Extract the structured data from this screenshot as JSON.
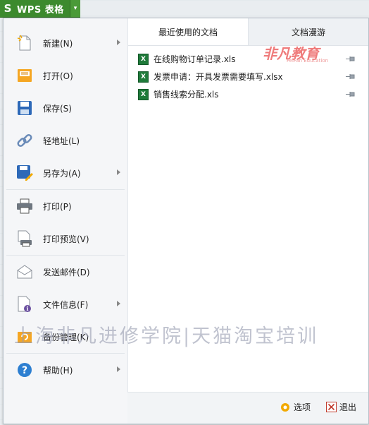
{
  "app": {
    "title": "WPS 表格"
  },
  "menu": {
    "items": [
      {
        "label": "新建(N)",
        "icon": "new-document-icon",
        "submenu": true
      },
      {
        "label": "打开(O)",
        "icon": "open-folder-icon",
        "submenu": false
      },
      {
        "label": "保存(S)",
        "icon": "save-disk-icon",
        "submenu": false
      },
      {
        "label": "轻地址(L)",
        "icon": "link-icon",
        "submenu": false
      },
      {
        "label": "另存为(A)",
        "icon": "save-as-icon",
        "submenu": true
      },
      {
        "label": "打印(P)",
        "icon": "printer-icon",
        "submenu": false
      },
      {
        "label": "打印预览(V)",
        "icon": "print-preview-icon",
        "submenu": false
      },
      {
        "label": "发送邮件(D)",
        "icon": "mail-icon",
        "submenu": false
      },
      {
        "label": "文件信息(F)",
        "icon": "file-info-icon",
        "submenu": true
      },
      {
        "label": "备份管理(K)",
        "icon": "backup-icon",
        "submenu": false
      },
      {
        "label": "帮助(H)",
        "icon": "help-icon",
        "submenu": true
      }
    ]
  },
  "tabs": {
    "recent": "最近使用的文档",
    "roaming": "文档漫游"
  },
  "recent_docs": [
    "在线购物订单记录.xls",
    "发票申请：开具发票需要填写.xlsx",
    "销售线索分配.xls"
  ],
  "footer": {
    "options": "选项",
    "exit": "退出"
  },
  "watermark": "上海非凡进修学院|天猫淘宝培训",
  "logo": {
    "text": "非凡教育",
    "sub": "FeiFan Education"
  },
  "colors": {
    "brand_green": "#3c8a2e",
    "panel": "#f5f6f8"
  }
}
